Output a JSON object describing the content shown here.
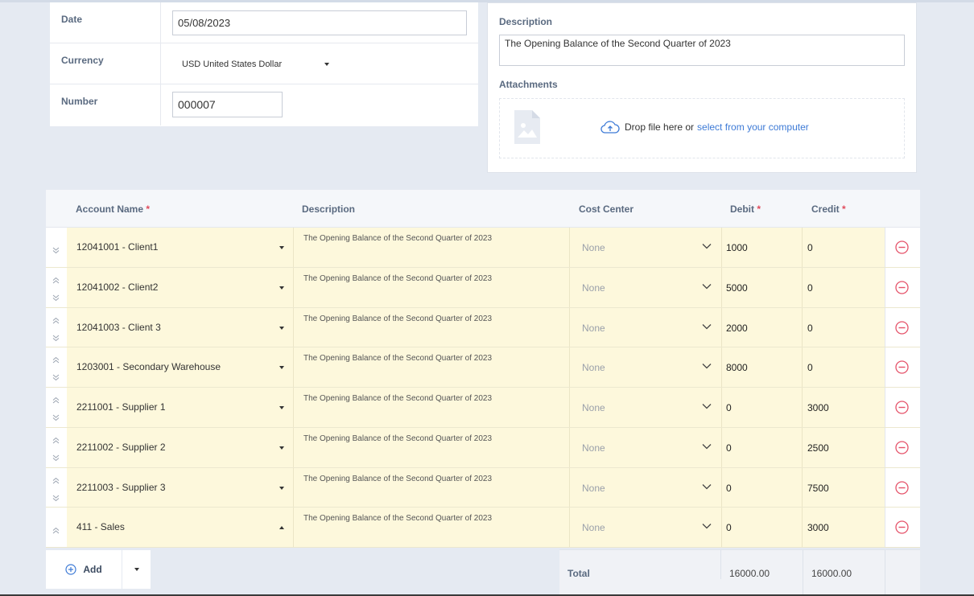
{
  "header": {
    "date_label": "Date",
    "date_value": "05/08/2023",
    "currency_label": "Currency",
    "currency_value": "USD United States Dollar",
    "number_label": "Number",
    "number_value": "000007"
  },
  "details": {
    "description_label": "Description",
    "description_value": "The Opening Balance of the Second Quarter of 2023",
    "attachments_label": "Attachments",
    "drop_text": "Drop file here or",
    "drop_link": "select from your computer"
  },
  "table": {
    "headers": {
      "account": "Account Name",
      "description": "Description",
      "cost_center": "Cost Center",
      "debit": "Debit",
      "credit": "Credit",
      "required_mark": "*"
    },
    "rows": [
      {
        "account": "12041001 - Client1",
        "description": "The Opening Balance of the Second Quarter of 2023",
        "cost_center": "None",
        "debit": "1000",
        "credit": "0"
      },
      {
        "account": "12041002 - Client2",
        "description": "The Opening Balance of the Second Quarter of 2023",
        "cost_center": "None",
        "debit": "5000",
        "credit": "0"
      },
      {
        "account": "12041003 - Client 3",
        "description": "The Opening Balance of the Second Quarter of 2023",
        "cost_center": "None",
        "debit": "2000",
        "credit": "0"
      },
      {
        "account": "1203001 - Secondary Warehouse",
        "description": "The Opening Balance of the Second Quarter of 2023",
        "cost_center": "None",
        "debit": "8000",
        "credit": "0"
      },
      {
        "account": "2211001 - Supplier 1",
        "description": "The Opening Balance of the Second Quarter of 2023",
        "cost_center": "None",
        "debit": "0",
        "credit": "3000"
      },
      {
        "account": "2211002 - Supplier 2",
        "description": "The Opening Balance of the Second Quarter of 2023",
        "cost_center": "None",
        "debit": "0",
        "credit": "2500"
      },
      {
        "account": "2211003 - Supplier 3",
        "description": "The Opening Balance of the Second Quarter of 2023",
        "cost_center": "None",
        "debit": "0",
        "credit": "7500"
      },
      {
        "account": "411 - Sales",
        "description": "The Opening Balance of the Second Quarter of 2023",
        "cost_center": "None",
        "debit": "0",
        "credit": "3000"
      }
    ]
  },
  "footer": {
    "add_label": "Add",
    "total_label": "Total",
    "total_debit": "16000.00",
    "total_credit": "16000.00"
  },
  "colors": {
    "row_bg": "#fdf8dc",
    "label": "#5a6a80",
    "required": "#e04b5c",
    "link": "#3d7ad6",
    "delete_icon": "#e5536a",
    "add_icon": "#3d7ad6"
  },
  "icons": [
    "file-image-icon",
    "cloud-upload-icon",
    "chevron-down-icon",
    "move-up-icon",
    "move-down-icon",
    "remove-row-icon",
    "add-circle-icon",
    "dropdown-caret-icon"
  ]
}
